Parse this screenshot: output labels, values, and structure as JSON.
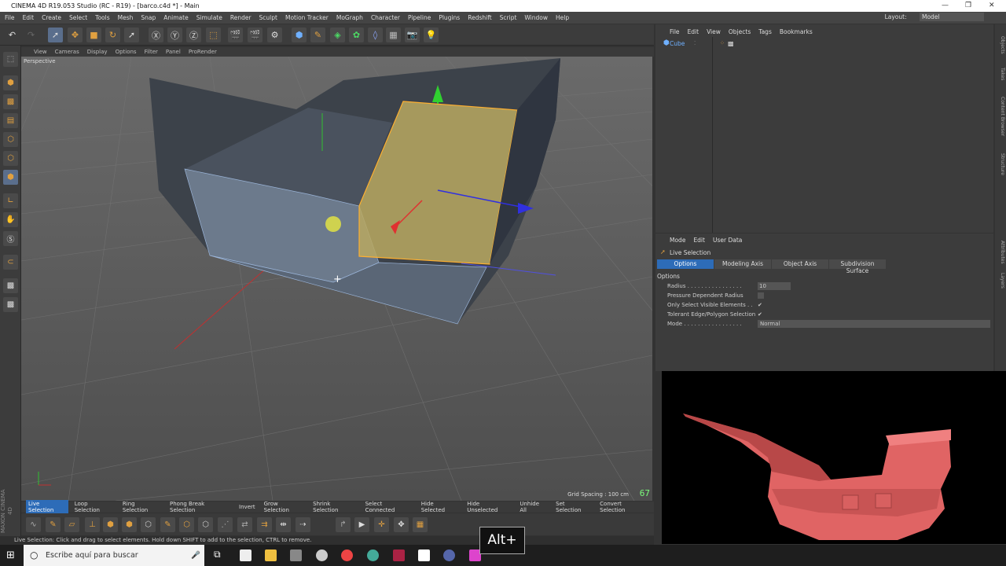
{
  "window": {
    "title": "CINEMA 4D R19.053 Studio (RC - R19) - [barco.c4d *] - Main",
    "controls": [
      "—",
      "❐",
      "✕"
    ]
  },
  "menubar": {
    "items": [
      "File",
      "Edit",
      "Create",
      "Select",
      "Tools",
      "Mesh",
      "Snap",
      "Animate",
      "Simulate",
      "Render",
      "Sculpt",
      "Motion Tracker",
      "MoGraph",
      "Character",
      "Pipeline",
      "Plugins",
      "Redshift",
      "Script",
      "Window",
      "Help"
    ],
    "layout_label": "Layout:",
    "layout_value": "Model"
  },
  "viewport": {
    "menu": [
      "View",
      "Cameras",
      "Display",
      "Options",
      "Filter",
      "Panel",
      "ProRender"
    ],
    "label": "Perspective",
    "grid_spacing": "Grid Spacing : 100 cm",
    "fps": "67"
  },
  "selection_bar": {
    "items": [
      "Live Selection",
      "Loop Selection",
      "Ring Selection",
      "Phong Break Selection",
      "Invert",
      "Grow Selection",
      "Shrink Selection",
      "Select Connected",
      "Hide Selected",
      "Hide Unselected",
      "Unhide All",
      "Set Selection",
      "Convert Selection"
    ],
    "active": "Live Selection"
  },
  "status": "Live Selection: Click and drag to select elements. Hold down SHIFT to add to the selection, CTRL to remove.",
  "maxon_logo": "MAXON CINEMA 4D",
  "object_manager": {
    "menu": [
      "File",
      "Edit",
      "View",
      "Objects",
      "Tags",
      "Bookmarks"
    ],
    "objects": [
      {
        "name": "Cube"
      }
    ]
  },
  "side_tabs": [
    "Objects",
    "Takes",
    "Content Browser",
    "Structure",
    "Attributes",
    "Layers"
  ],
  "attribute_manager": {
    "menu": [
      "Mode",
      "Edit",
      "User Data"
    ],
    "title": "Live Selection",
    "tabs": [
      "Options",
      "Modeling Axis",
      "Object Axis",
      "Subdivision Surface"
    ],
    "active_tab": "Options",
    "section": "Options",
    "params": [
      {
        "label": "Radius . . . . . . . . . . . . . . . .",
        "value": "10"
      },
      {
        "label": "Pressure Dependent Radius",
        "value": ""
      },
      {
        "label": "Only Select Visible Elements . .",
        "value": "✔"
      },
      {
        "label": "Tolerant Edge/Polygon Selection",
        "value": "✔"
      },
      {
        "label": "Mode . . . . . . . . . . . . . . . . .",
        "value": "Normal"
      }
    ]
  },
  "taskbar": {
    "search_placeholder": "Escribe aquí para buscar"
  },
  "overlay": {
    "keys": "Alt+"
  },
  "colors": {
    "selection_blue": "#2d6cb8",
    "polygon_selected": "#b8a860",
    "ship_red": "#e06464"
  }
}
